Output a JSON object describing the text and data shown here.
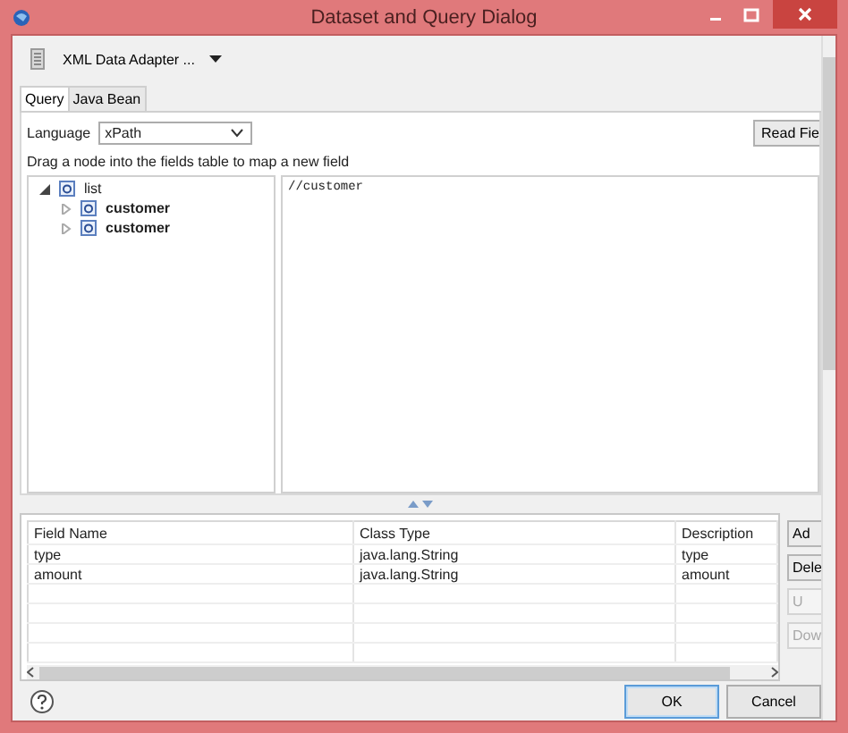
{
  "window": {
    "title": "Dataset and Query Dialog"
  },
  "toolbar": {
    "adapter": "XML Data Adapter ..."
  },
  "tabs": [
    {
      "label": "Query",
      "selected": true
    },
    {
      "label": "Java Bean",
      "selected": false
    }
  ],
  "language": {
    "label": "Language",
    "value": "xPath"
  },
  "read_fields_button": "Read Fie",
  "hint": "Drag a node into the fields table to map a new field",
  "tree": [
    {
      "label": "list",
      "expanded": true,
      "children": [
        {
          "label": "customer",
          "expanded": false
        },
        {
          "label": "customer",
          "expanded": false
        }
      ]
    }
  ],
  "query": "//customer",
  "fields_table": {
    "columns": [
      "Field Name",
      "Class Type",
      "Description"
    ],
    "rows": [
      [
        "type",
        "java.lang.String",
        "type"
      ],
      [
        "amount",
        "java.lang.String",
        "amount"
      ]
    ]
  },
  "side_buttons": [
    {
      "label": "Ad",
      "disabled": false
    },
    {
      "label": "Dele",
      "disabled": false
    },
    {
      "label": "U",
      "disabled": true
    },
    {
      "label": "Dow",
      "disabled": true
    }
  ],
  "buttons": [
    {
      "label": "OK",
      "default": true
    },
    {
      "label": "Cancel",
      "default": false
    }
  ]
}
